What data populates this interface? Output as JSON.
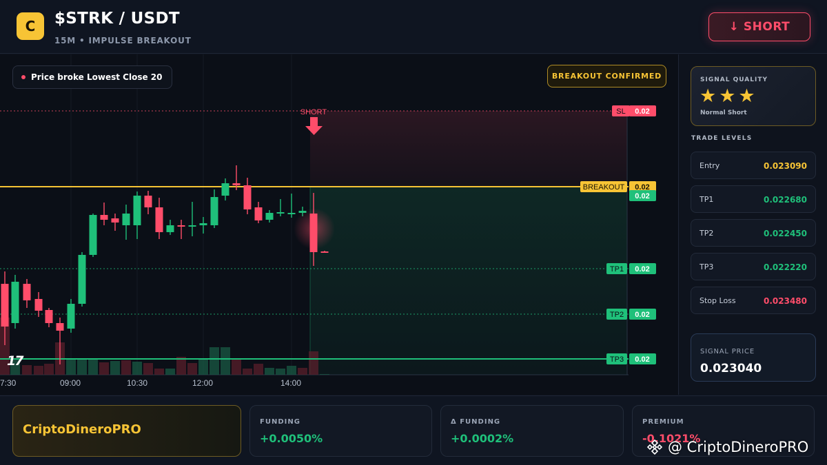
{
  "header": {
    "logo_letter": "C",
    "pair": "$STRK / USDT",
    "subtitle": "15M • IMPULSE BREAKOUT",
    "short_button": "↓ SHORT"
  },
  "chart": {
    "status_pill": "Price broke Lowest Close 20",
    "confirm_badge": "BREAKOUT CONFIRMED",
    "short_marker": "SHORT",
    "tv_logo": "17",
    "x_labels": [
      "7:30",
      "09:00",
      "10:30",
      "12:00",
      "14:00"
    ],
    "levels": [
      {
        "name": "SL",
        "value": "0.02",
        "color": "#ff4d6a"
      },
      {
        "name": "BREAKOUT",
        "value": "0.02",
        "color": "#f7c435"
      },
      {
        "name": "",
        "value": "0.02",
        "color": "#1fc07a"
      },
      {
        "name": "TP1",
        "value": "0.02",
        "color": "#1fc07a"
      },
      {
        "name": "TP2",
        "value": "0.02",
        "color": "#1fc07a"
      },
      {
        "name": "TP3",
        "value": "0.02",
        "color": "#1fc07a"
      }
    ]
  },
  "sidebar": {
    "quality_label": "SIGNAL QUALITY",
    "stars": "★★★",
    "quality_sub": "Normal Short",
    "levels_title": "TRADE LEVELS",
    "trade_levels": [
      {
        "name": "Entry",
        "value": "0.023090",
        "color": "#f7c435"
      },
      {
        "name": "TP1",
        "value": "0.022680",
        "color": "#1fc07a"
      },
      {
        "name": "TP2",
        "value": "0.022450",
        "color": "#1fc07a"
      },
      {
        "name": "TP3",
        "value": "0.022220",
        "color": "#1fc07a"
      },
      {
        "name": "Stop Loss",
        "value": "0.023480",
        "color": "#ff4d6a"
      }
    ],
    "signal_price_label": "SIGNAL PRICE",
    "signal_price": "0.023040"
  },
  "footer": {
    "brand": "CriptoDineroPRO",
    "stats": [
      {
        "label": "FUNDING",
        "value": "+0.0050%",
        "color": "#1fc07a"
      },
      {
        "label": "Δ FUNDING",
        "value": "+0.0002%",
        "color": "#1fc07a"
      },
      {
        "label": "PREMIUM",
        "value": "-0.1021%",
        "color": "#ff4d6a"
      }
    ],
    "watermark": "@ CriptoDineroPRO"
  },
  "colors": {
    "up": "#1fc07a",
    "down": "#ff4d6a",
    "accent": "#f7c435"
  },
  "icons": {
    "logo": "coin-c-icon",
    "watermark": "binance-diamond-icon"
  }
}
